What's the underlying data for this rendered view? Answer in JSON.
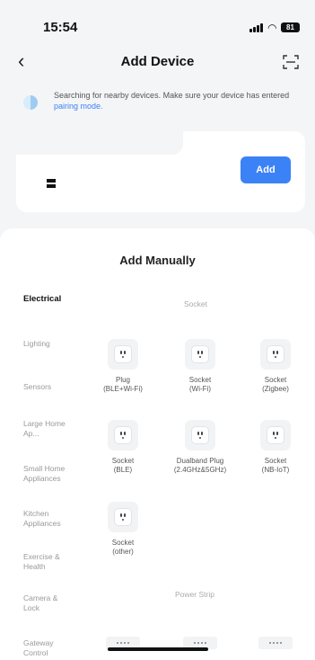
{
  "status_bar": {
    "time": "15:54",
    "battery": "81"
  },
  "nav": {
    "title": "Add Device",
    "back_icon": "chevron-left-icon",
    "scan_icon": "scan-icon"
  },
  "search_tip": {
    "text": "Searching for nearby devices. Make sure your device has entered ",
    "link": "pairing mode."
  },
  "found_device": {
    "add_label": "Add"
  },
  "manual": {
    "title": "Add Manually",
    "categories": [
      {
        "label": "Electrical",
        "active": true
      },
      {
        "label": "Lighting"
      },
      {
        "label": "Sensors"
      },
      {
        "label": "Large Home Ap..."
      },
      {
        "label": "Small Home Appliances"
      },
      {
        "label": "Kitchen Appliances"
      },
      {
        "label": "Exercise & Health"
      },
      {
        "label": "Camera & Lock"
      },
      {
        "label": "Gateway Control"
      }
    ],
    "socket_section": "Socket",
    "devices": [
      {
        "line1": "Plug",
        "line2": "(BLE+Wi-Fi)"
      },
      {
        "line1": "Socket",
        "line2": "(Wi-Fi)"
      },
      {
        "line1": "Socket",
        "line2": "(Zigbee)"
      },
      {
        "line1": "Socket",
        "line2": "(BLE)"
      },
      {
        "line1": "Dualband Plug",
        "line2": "(2.4GHz&5GHz)"
      },
      {
        "line1": "Socket",
        "line2": "(NB-IoT)"
      },
      {
        "line1": "Socket",
        "line2": "(other)"
      }
    ],
    "power_strip_section": "Power Strip"
  }
}
